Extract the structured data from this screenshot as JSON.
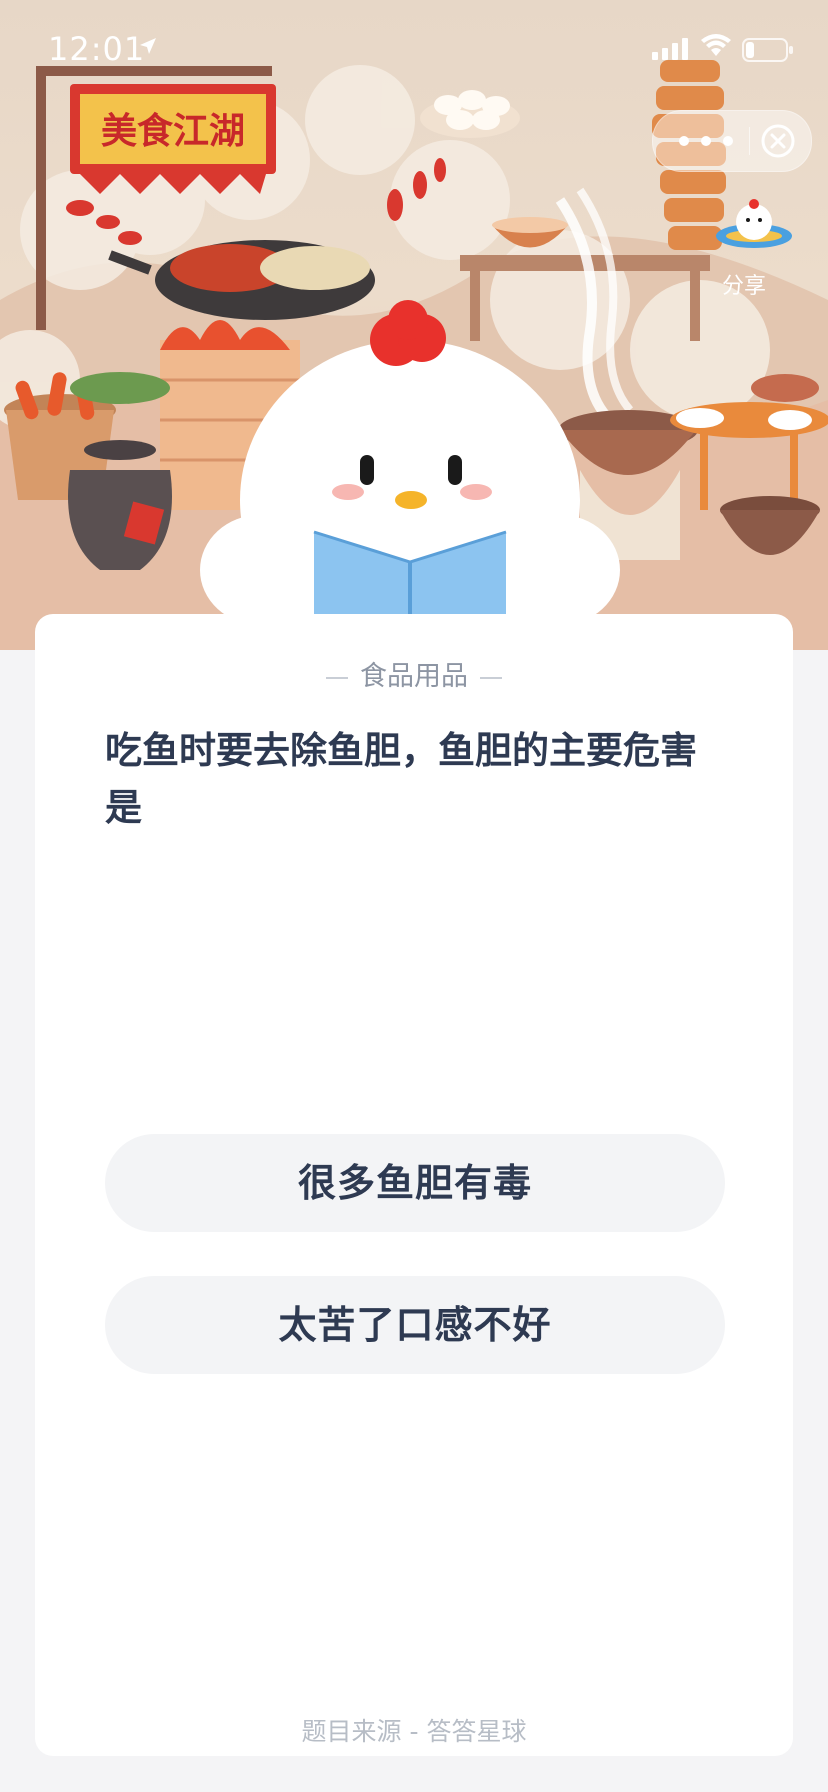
{
  "status_bar": {
    "time": "12:01",
    "icons": [
      "location-arrow-icon",
      "signal-icon",
      "wifi-icon",
      "battery-icon"
    ]
  },
  "capsule": {
    "more_icon": "more-dots-icon",
    "close_icon": "close-circle-icon"
  },
  "share": {
    "label": "分享",
    "icon": "planet-mascot-icon"
  },
  "banner": {
    "sign_text": "美食江湖"
  },
  "question_card": {
    "category": "食品用品",
    "question": "吃鱼时要去除鱼胆，鱼胆的主要危害是",
    "options": [
      {
        "label": "很多鱼胆有毒"
      },
      {
        "label": "太苦了口感不好"
      }
    ],
    "source": "题目来源 - 答答星球"
  },
  "colors": {
    "text_primary": "#2e3a52",
    "text_muted": "#8d95a3",
    "option_bg": "#f3f4f6",
    "page_bg": "#f4f4f6",
    "sign_red": "#d9382f"
  }
}
